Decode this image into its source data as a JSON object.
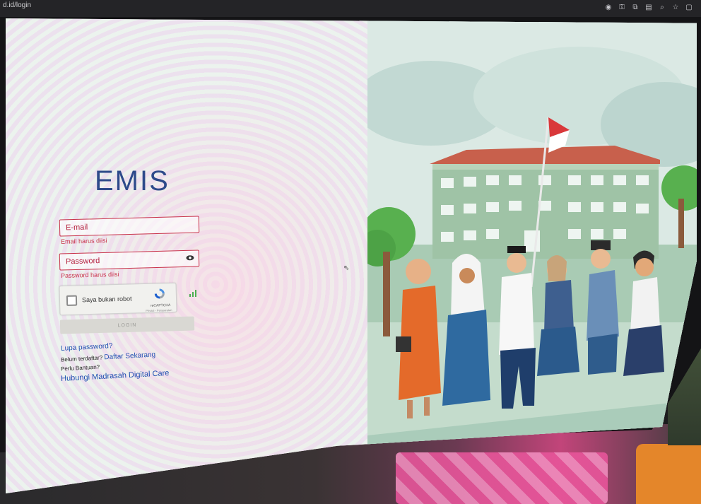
{
  "browser": {
    "url": "d.id/login",
    "icons": [
      "location-icon",
      "key-icon",
      "translate-icon",
      "reader-icon",
      "zoom-icon",
      "star-icon",
      "menu-icon"
    ]
  },
  "logo": {
    "text": "EMIS"
  },
  "form": {
    "email": {
      "placeholder": "E-mail",
      "error": "Email harus diisi"
    },
    "password": {
      "placeholder": "Password",
      "error": "Password harus diisi"
    },
    "captcha": {
      "label": "Saya bukan robot",
      "brand": "reCAPTCHA",
      "terms": "Privasi - Persyaratan"
    },
    "login_label": "LOGIN"
  },
  "links": {
    "forgot": "Lupa password?",
    "register_prompt": "Belum terdaftar?",
    "register_link": "Daftar Sekarang",
    "help_prompt": "Perlu Bantuan?",
    "help_link": "Hubungi Madrasah Digital Care"
  },
  "colors": {
    "error_red": "#c8324a",
    "link_blue": "#1f4fb0",
    "logo_blue": "#2d4a8a"
  }
}
